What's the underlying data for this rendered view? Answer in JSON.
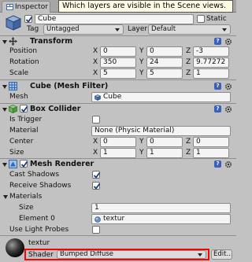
{
  "tab": {
    "label": "Inspector"
  },
  "tooltip": {
    "text": "Which layers are visible in the Scene views."
  },
  "header": {
    "active": true,
    "name": "Cube",
    "static_label": "Static",
    "static_checked": false,
    "tag_label": "Tag",
    "tag_value": "Untagged",
    "layer_label": "Layer",
    "layer_value": "Default"
  },
  "transform": {
    "title": "Transform",
    "position_label": "Position",
    "rotation_label": "Rotation",
    "scale_label": "Scale",
    "x_label": "X",
    "y_label": "Y",
    "z_label": "Z",
    "position": {
      "x": "0",
      "y": "0",
      "z": "-3"
    },
    "rotation": {
      "x": "350",
      "y": "24",
      "z": "9.77272"
    },
    "scale": {
      "x": "5",
      "y": "5",
      "z": "1"
    }
  },
  "mesh_filter": {
    "title": "Cube (Mesh Filter)",
    "mesh_label": "Mesh",
    "mesh_value": "Cube"
  },
  "box_collider": {
    "title": "Box Collider",
    "enabled": true,
    "is_trigger_label": "Is Trigger",
    "is_trigger": false,
    "material_label": "Material",
    "material_value": "None (Physic Material)",
    "center_label": "Center",
    "size_label": "Size",
    "x_label": "X",
    "y_label": "Y",
    "z_label": "Z",
    "center": {
      "x": "0",
      "y": "0",
      "z": "0"
    },
    "size": {
      "x": "1",
      "y": "1",
      "z": "1"
    }
  },
  "mesh_renderer": {
    "title": "Mesh Renderer",
    "enabled": true,
    "cast_shadows_label": "Cast Shadows",
    "cast_shadows": true,
    "receive_shadows_label": "Receive Shadows",
    "receive_shadows": true,
    "materials_label": "Materials",
    "size_label": "Size",
    "size_value": "1",
    "element0_label": "Element 0",
    "element0_value": "textur",
    "use_light_probes_label": "Use Light Probes",
    "use_light_probes": false
  },
  "material": {
    "name": "textur",
    "shader_label": "Shader",
    "shader_value": "Bumped Diffuse",
    "edit_label": "Edit..."
  },
  "colors": {
    "background": "#c2c2c2",
    "tooltip_bg": "#fffde6",
    "highlight_border": "#ff0000",
    "help_icon": "#3a5fbf"
  },
  "icons": [
    "inspector-icon",
    "gameobject-cube-icon",
    "transform-icon",
    "mesh-filter-icon",
    "box-collider-icon",
    "mesh-renderer-icon",
    "help-icon",
    "gear-icon",
    "material-sphere-icon"
  ]
}
